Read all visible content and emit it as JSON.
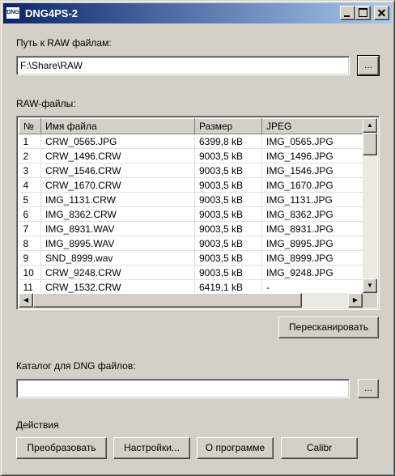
{
  "window": {
    "icon_text": "DNG",
    "title": "DNG4PS-2"
  },
  "raw_path": {
    "label": "Путь к RAW файлам:",
    "value": "F:\\Share\\RAW",
    "browse_label": "..."
  },
  "files": {
    "label": "RAW-файлы:",
    "columns": [
      "№",
      "Имя файла",
      "Размер",
      "JPEG"
    ],
    "rows": [
      [
        "1",
        "CRW_0565.JPG",
        "6399,8 kB",
        "IMG_0565.JPG"
      ],
      [
        "2",
        "CRW_1496.CRW",
        "9003,5 kB",
        "IMG_1496.JPG"
      ],
      [
        "3",
        "CRW_1546.CRW",
        "9003,5 kB",
        "IMG_1546.JPG"
      ],
      [
        "4",
        "CRW_1670.CRW",
        "9003,5 kB",
        "IMG_1670.JPG"
      ],
      [
        "5",
        "IMG_1131.CRW",
        "9003,5 kB",
        "IMG_1131.JPG"
      ],
      [
        "6",
        "IMG_8362.CRW",
        "9003,5 kB",
        "IMG_8362.JPG"
      ],
      [
        "7",
        "IMG_8931.WAV",
        "9003,5 kB",
        "IMG_8931.JPG"
      ],
      [
        "8",
        "IMG_8995.WAV",
        "9003,5 kB",
        "IMG_8995.JPG"
      ],
      [
        "9",
        "SND_8999.wav",
        "9003,5 kB",
        "IMG_8999.JPG"
      ],
      [
        "10",
        "CRW_9248.CRW",
        "9003,5 kB",
        "IMG_9248.JPG"
      ],
      [
        "11",
        "CRW_1532.CRW",
        "6419,1 kB",
        "-"
      ]
    ],
    "rescan_label": "Пересканировать"
  },
  "dng_dir": {
    "label": "Каталог для DNG файлов:",
    "value": "",
    "browse_label": "..."
  },
  "actions": {
    "label": "Действия",
    "convert_label": "Преобразовать",
    "settings_label": "Настройки...",
    "about_label": "О программе",
    "calibr_label": "Calibr"
  }
}
